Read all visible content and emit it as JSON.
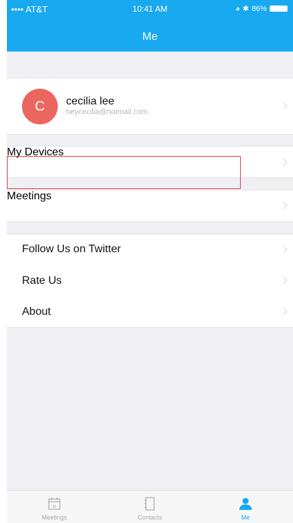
{
  "status": {
    "carrier": "•••• AT&T",
    "time": "10:41 AM",
    "battery": "86%"
  },
  "header": {
    "title": "Me"
  },
  "profile": {
    "initial": "C",
    "name": "cecilia lee",
    "email": "heycecilia@hotmail.com"
  },
  "menu": {
    "my_devices": "My Devices",
    "meetings": "Meetings",
    "follow_twitter": "Follow Us on Twitter",
    "rate_us": "Rate Us",
    "about": "About"
  },
  "tabs": [
    {
      "label": "Meetings",
      "icon": "calendar-icon"
    },
    {
      "label": "Contacts",
      "icon": "contacts-book-icon"
    },
    {
      "label": "Me",
      "icon": "person-icon"
    }
  ],
  "colors": {
    "accent": "#19a9f0",
    "avatar": "#ec6660",
    "highlight": "#e43c3c"
  }
}
